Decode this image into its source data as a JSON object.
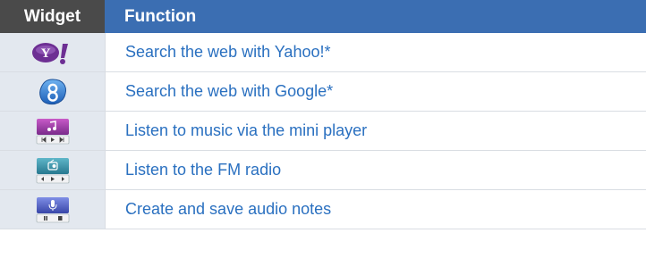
{
  "table": {
    "header": {
      "widget": "Widget",
      "function": "Function"
    },
    "rows": [
      {
        "icon": "yahoo-widget-icon",
        "text": "Search the web with Yahoo!*"
      },
      {
        "icon": "google-widget-icon",
        "text": "Search the web with Google*"
      },
      {
        "icon": "music-player-widget-icon",
        "text": "Listen to music via the mini player"
      },
      {
        "icon": "fm-radio-widget-icon",
        "text": "Listen to the FM radio"
      },
      {
        "icon": "voice-recorder-widget-icon",
        "text": "Create and save audio notes"
      }
    ]
  },
  "colors": {
    "header_dark": "#4a4a4a",
    "header_blue": "#3b6eb2",
    "icon_col_bg": "#e3e8ef",
    "link_text": "#2a70c0"
  },
  "logo_text": {
    "yahoo": "Y!"
  }
}
